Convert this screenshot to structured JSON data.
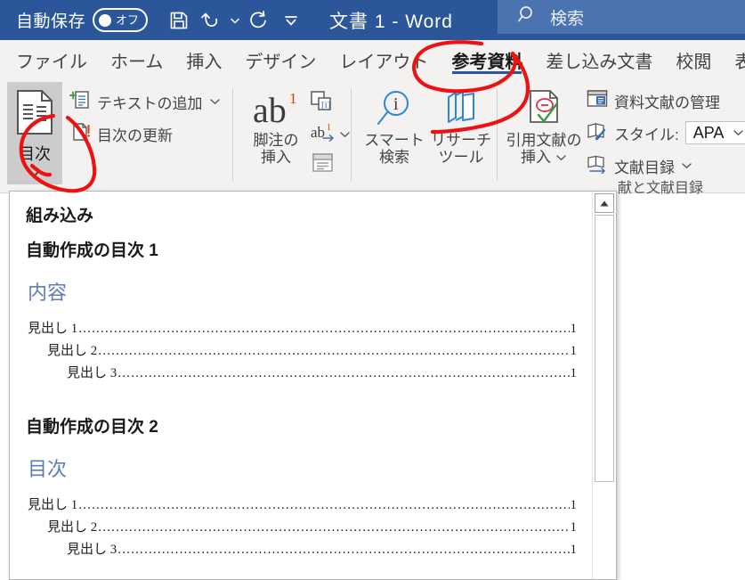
{
  "titlebar": {
    "autosave_label": "自動保存",
    "autosave_state": "オフ",
    "doc_title": "文書 1  -  Word",
    "qat": [
      {
        "name": "save-icon",
        "label": "保存"
      },
      {
        "name": "undo-icon",
        "label": "元に戻す"
      },
      {
        "name": "redo-icon",
        "label": "やり直し"
      },
      {
        "name": "customize-qat-icon",
        "label": "クイック アクセス ツール バーのユーザー設定"
      }
    ],
    "search": {
      "placeholder": "検索",
      "icon": "search-icon"
    },
    "colors": {
      "titlebar_bg": "#2b579a",
      "search_bg": "#4a73b0"
    }
  },
  "tabs": [
    {
      "label": "ファイル",
      "active": false
    },
    {
      "label": "ホーム",
      "active": false
    },
    {
      "label": "挿入",
      "active": false
    },
    {
      "label": "デザイン",
      "active": false
    },
    {
      "label": "レイアウト",
      "active": false
    },
    {
      "label": "参考資料",
      "active": true
    },
    {
      "label": "差し込み文書",
      "active": false
    },
    {
      "label": "校閲",
      "active": false
    },
    {
      "label": "表",
      "active": false
    }
  ],
  "ribbon": {
    "toc_group": {
      "button_label": "目次",
      "items": [
        {
          "label": "テキストの追加",
          "icon": "add-text-icon",
          "has_chevron": true
        },
        {
          "label": "目次の更新",
          "icon": "update-toc-icon",
          "has_chevron": false
        }
      ]
    },
    "footnote_group": {
      "main_label_line1": "脚注の",
      "main_label_line2": "挿入",
      "main_icon": "ab-superscript-icon",
      "items": [
        {
          "icon": "insert-endnote-icon",
          "has_chevron": false
        },
        {
          "icon": "next-footnote-icon",
          "has_chevron": true
        },
        {
          "icon": "show-notes-icon",
          "has_chevron": false
        }
      ]
    },
    "research_group": {
      "smart_lookup": {
        "line1": "スマート",
        "line2": "検索",
        "icon": "smart-lookup-icon"
      },
      "researcher": {
        "line1": "リサーチ",
        "line2": "ツール",
        "icon": "researcher-icon"
      }
    },
    "citation_group": {
      "insert_citation": {
        "line1": "引用文献の",
        "line2": "挿入",
        "icon": "insert-citation-icon",
        "has_chevron": true
      },
      "items": [
        {
          "label": "資料文献の管理",
          "icon": "manage-sources-icon",
          "has_chevron": false
        },
        {
          "label": "スタイル:",
          "icon": "style-icon",
          "value": "APA",
          "has_chevron": true
        },
        {
          "label": "文献目録",
          "icon": "bibliography-icon",
          "has_chevron": true
        }
      ],
      "group_label": "引用文献と文献目録",
      "group_label_visible": "献と文献目録"
    }
  },
  "gallery": {
    "header": "組み込み",
    "scrollbar": {
      "up_arrow": "scroll-up-icon"
    },
    "items": [
      {
        "title": "自動作成の目次 1",
        "toc_title": "内容",
        "entries": [
          {
            "text": "見出し 1",
            "level": 1,
            "page": "1"
          },
          {
            "text": "見出し 2",
            "level": 2,
            "page": "1"
          },
          {
            "text": "見出し 3",
            "level": 3,
            "page": "1"
          }
        ]
      },
      {
        "title": "自動作成の目次 2",
        "toc_title": "目次",
        "entries": [
          {
            "text": "見出し 1",
            "level": 1,
            "page": "1"
          },
          {
            "text": "見出し 2",
            "level": 2,
            "page": "1"
          },
          {
            "text": "見出し 3",
            "level": 3,
            "page": "1"
          }
        ]
      }
    ]
  },
  "annotations": {
    "color": "#ee1111",
    "marks": [
      {
        "name": "circle-around-references-tab",
        "target": "参考資料"
      },
      {
        "name": "circle-around-toc-button",
        "target": "目次"
      }
    ]
  }
}
